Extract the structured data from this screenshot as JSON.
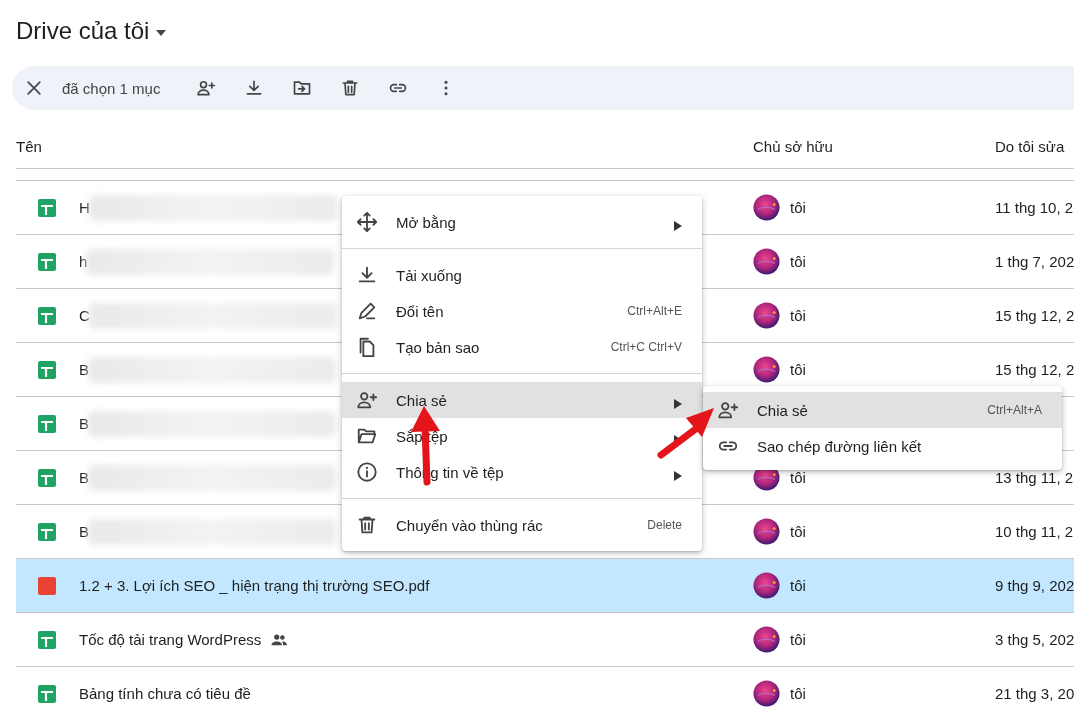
{
  "title": "Drive của tôi",
  "toolbar": {
    "selection": "đã chọn 1 mục"
  },
  "table": {
    "columns": [
      "Tên",
      "Chủ sở hữu",
      "Do tôi sửa"
    ],
    "rows": [
      {
        "kind": "sheet",
        "name": "H",
        "blurred": true,
        "shared": false,
        "owner": "tôi",
        "modified": "11 thg 10, 2",
        "selected": false
      },
      {
        "kind": "sheet",
        "name": "h",
        "blurred": true,
        "shared": false,
        "owner": "tôi",
        "modified": "1 thg 7, 202",
        "selected": false
      },
      {
        "kind": "sheet",
        "name": "C",
        "blurred": true,
        "shared": false,
        "owner": "tôi",
        "modified": "15 thg 12, 2",
        "selected": false
      },
      {
        "kind": "sheet",
        "name": "B",
        "blurred": true,
        "shared": false,
        "owner": "tôi",
        "modified": "15 thg 12, 2",
        "selected": false
      },
      {
        "kind": "sheet",
        "name": "B",
        "blurred": true,
        "shared": false,
        "selected": false
      },
      {
        "kind": "sheet",
        "name": "B",
        "blurred": true,
        "shared": false,
        "owner": "tôi",
        "modified": "13 thg 11, 2",
        "selected": false
      },
      {
        "kind": "sheet",
        "name": "B",
        "blurred": true,
        "shared": false,
        "owner": "tôi",
        "modified": "10 thg 11, 2",
        "selected": false
      },
      {
        "kind": "pdf",
        "name": "1.2 + 3. Lợi ích SEO _ hiện trạng thị trường SEO.pdf",
        "blurred": false,
        "shared": false,
        "owner": "tôi",
        "modified": "9 thg 9, 202",
        "selected": true
      },
      {
        "kind": "sheet",
        "name": "Tốc độ tải trang WordPress",
        "blurred": false,
        "shared": true,
        "owner": "tôi",
        "modified": "3 thg 5, 202",
        "selected": false
      },
      {
        "kind": "sheet",
        "name": "Bảng tính chưa có tiêu đề",
        "blurred": false,
        "shared": false,
        "owner": "tôi",
        "modified": "21 thg 3, 20",
        "selected": false
      }
    ]
  },
  "context_menu": {
    "sections": [
      [
        {
          "kind": "move",
          "label": "Mở bằng",
          "submenu": true,
          "highlighted": false
        }
      ],
      [
        {
          "kind": "download",
          "label": "Tải xuống",
          "submenu": false,
          "highlighted": false
        },
        {
          "kind": "rename",
          "label": "Đổi tên",
          "shortcut": "Ctrl+Alt+E",
          "submenu": false,
          "highlighted": false
        },
        {
          "kind": "copy",
          "label": "Tạo bản sao",
          "shortcut": "Ctrl+C Ctrl+V",
          "submenu": false,
          "highlighted": false
        }
      ],
      [
        {
          "kind": "share",
          "label": "Chia sẻ",
          "submenu": true,
          "highlighted": true
        },
        {
          "kind": "folder",
          "label": "Sắp tệp",
          "submenu": true,
          "highlighted": false
        },
        {
          "kind": "info",
          "label": "Thông tin về tệp",
          "submenu": true,
          "highlighted": false
        }
      ],
      [
        {
          "kind": "trash",
          "label": "Chuyển vào thùng rác",
          "shortcut": "Delete",
          "submenu": false,
          "highlighted": false
        }
      ]
    ]
  },
  "submenu": {
    "items": [
      {
        "kind": "share",
        "label": "Chia sẻ",
        "shortcut": "Ctrl+Alt+A",
        "highlighted": true
      },
      {
        "kind": "link",
        "label": "Sao chép đường liên kết",
        "highlighted": false
      }
    ]
  }
}
